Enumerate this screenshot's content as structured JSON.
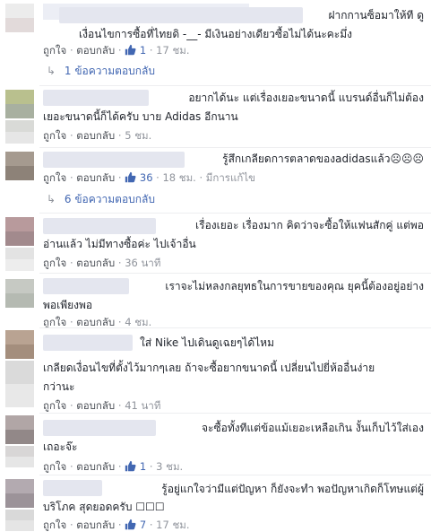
{
  "actions": {
    "like": "ถูกใจ",
    "reply": "ตอบกลับ",
    "dot": "·",
    "edited": "มีการแก้ไข"
  },
  "comments": [
    {
      "lines": [
        "ฝากกานซ็อมาให้ที ดู",
        "เงื่อนไขการซื้อที่ไทยดิ -__- มีเงินอย่างเดียวซื้อไม่ได้นะคะมึ่ง"
      ],
      "likes": "1",
      "time": "17 ชม.",
      "replies_label": "1 ข้อความตอบกลับ"
    },
    {
      "lines": [
        "อยากได้นะ แต่เรื่องเยอะขนาดนี้ แบรนด์อื่นก็ไม่ต้อง",
        "เยอะขนาดนี้ก็ได้ครับ บาย Adidas อีกนาน"
      ],
      "time": "5 ชม."
    },
    {
      "lines": [
        "รู้สึกเกลียดการตลาดของadidasแล้ว☹☹☹"
      ],
      "likes": "36",
      "time": "18 ชม.",
      "replies_label": "6 ข้อความตอบกลับ"
    },
    {
      "lines": [
        "เรื่องเยอะ เรื่องมาก คิดว่าจะซื้อให้แฟนสักคู่ แต่พอ",
        "อ่านแล้ว ไม่มีทางซื้อค่ะ ไปเจ้าอื่น"
      ],
      "time": "36 นาที"
    },
    {
      "lines": [
        "เราจะไม่หลงกลยุทธในการขายของคุณ ยุคนี้ต้องอยู่อย่าง",
        "พอเพียงพอ"
      ],
      "time": "4 ชม."
    },
    {
      "lines": [
        "ใส่ Nike ไปเดินดูเฉยๆได้ไหม",
        "เกลียดเงื่อนไขที่ตั้งไว้มากๆเลย ถ้าจะซื้อยากขนาดนี้ เปลี่ยนไปยี่ห้ออื่นง่าย",
        "กว่านะ"
      ],
      "time": "41 นาที"
    },
    {
      "lines": [
        "จะซื้อทั้งทีแต่ข้อแม้เยอะเหลือเกิน งั้นเก็บไว้ใส่เอง",
        "เถอะจ๊ะ"
      ],
      "likes": "1",
      "time": "3 ชม."
    },
    {
      "lines": [
        "รู้อยู่แกใจว่ามีแต่ปัญหา ก็ยังจะทำ พอปัญหาเกิดก็โทษแต่ผู้",
        "บริโภค สุดยอดครับ ☐☐☐"
      ],
      "likes": "7",
      "time": "17 ชม."
    }
  ],
  "colors": {
    "link": "#4267b2",
    "meta": "#90949c",
    "text": "#1d2129",
    "like_icon": "#4267b2"
  }
}
